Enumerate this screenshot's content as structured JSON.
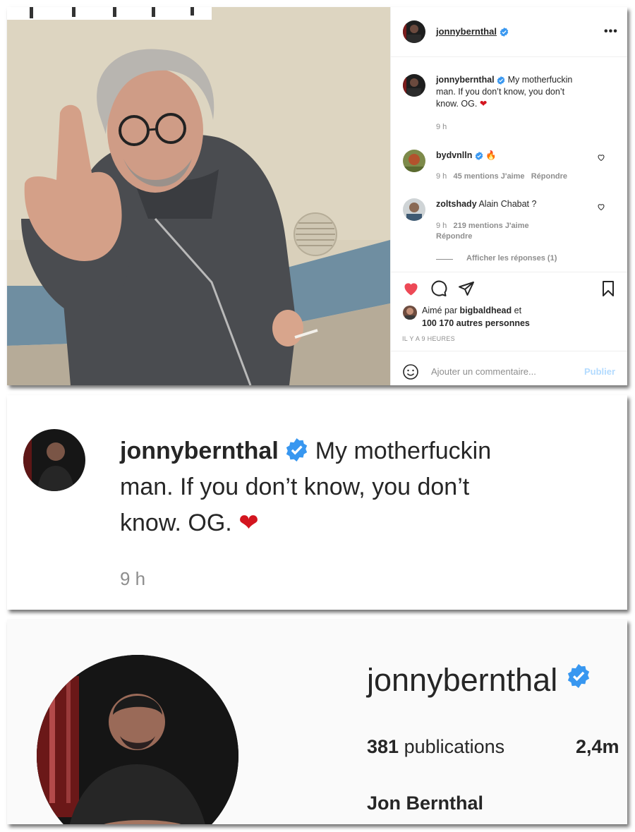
{
  "post": {
    "header": {
      "username": "jonnybernthal",
      "more_icon": "more-dots-icon"
    },
    "caption": {
      "username": "jonnybernthal",
      "text_line1": "My motherfuckin",
      "text_line2": "man. If you don’t know, you don’t",
      "text_line3": "know. OG.",
      "time": "9 h"
    },
    "comments": [
      {
        "username": "bydvnlln",
        "text": "",
        "time": "9 h",
        "likes": "45 mentions J'aime",
        "reply": "Répondre"
      },
      {
        "username": "zoltshady",
        "text": "Alain Chabat ?",
        "time": "9 h",
        "likes": "219 mentions J'aime",
        "reply": "Répondre",
        "view_replies": "Afficher les réponses (1)"
      }
    ],
    "likes": {
      "prefix": "Aimé par",
      "user": "bigbaldhead",
      "joiner": "et",
      "others": "100 170 autres personnes"
    },
    "timestamp": "IL Y A 9 HEURES",
    "comment_input": {
      "placeholder": "Ajouter un commentaire...",
      "publish": "Publier"
    },
    "colors": {
      "verified": "#3897f0",
      "like_red": "#ed4956",
      "publish_blue": "#b3dbff"
    }
  },
  "zoom_caption": {
    "username": "jonnybernthal",
    "text_line1": "My motherfuckin",
    "text_line2": "man. If you don’t know, you don’t",
    "text_line3": "know. OG.",
    "time": "9 h"
  },
  "profile": {
    "username": "jonnybernthal",
    "posts_count": "381",
    "posts_label": "publications",
    "followers_partial": "2,4m",
    "full_name": "Jon Bernthal"
  }
}
